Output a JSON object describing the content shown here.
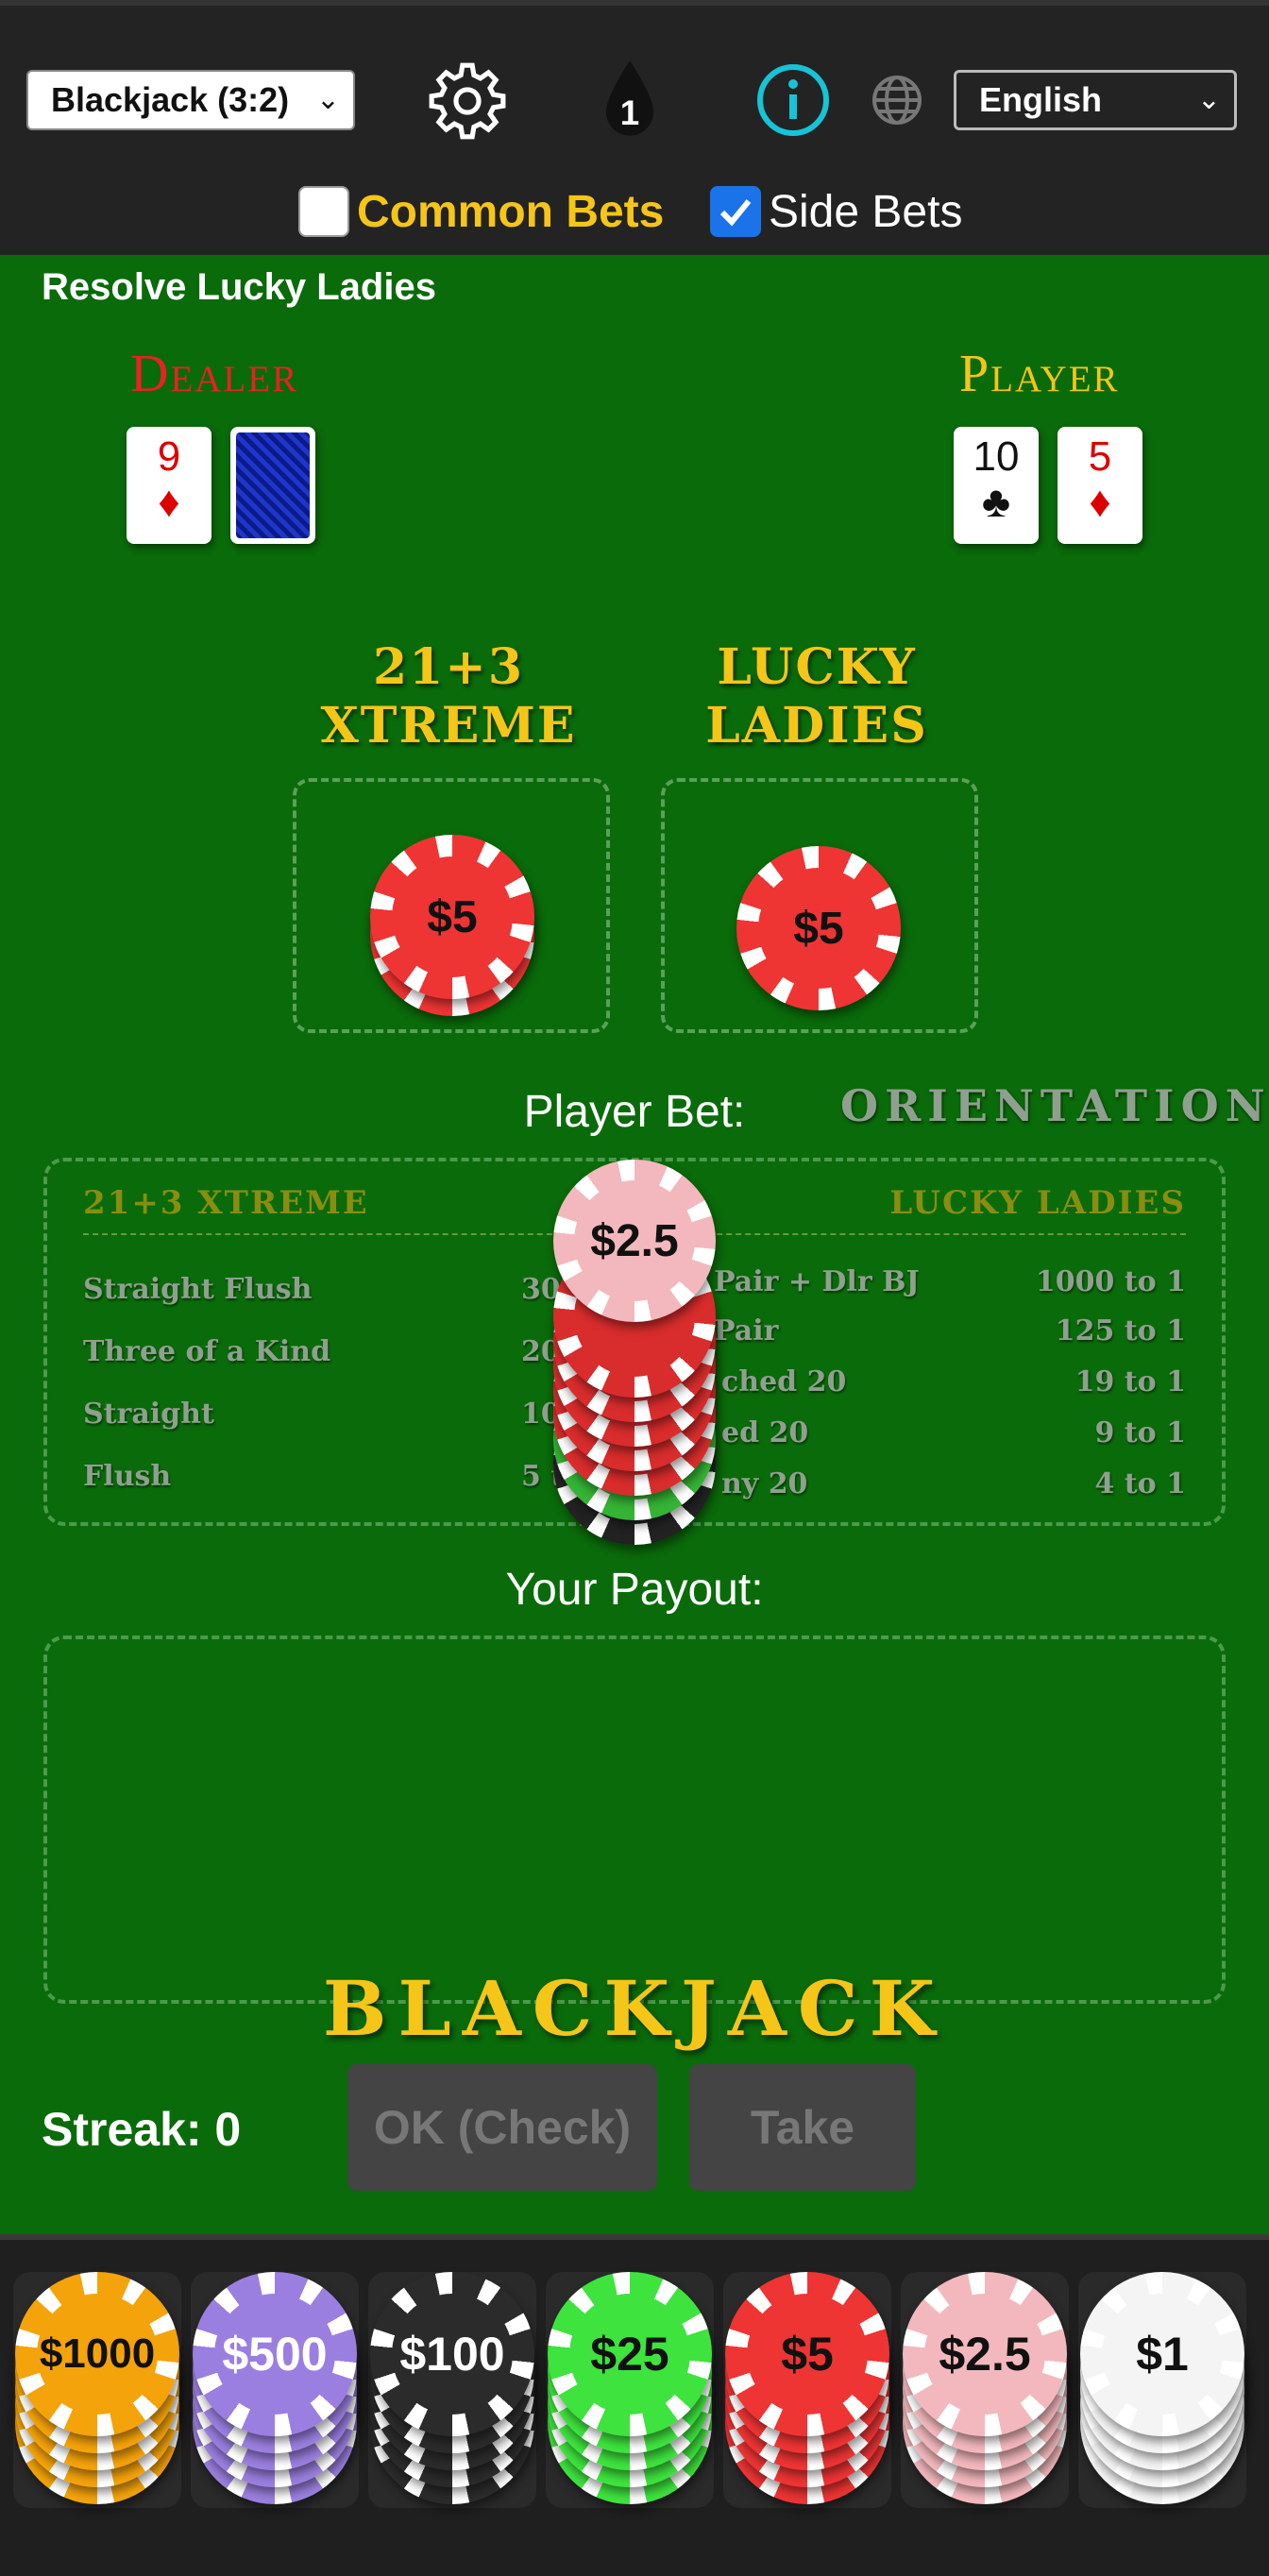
{
  "header": {
    "game_select": "Blackjack (3:2)",
    "count_badge": "1",
    "language_select": "English",
    "options": {
      "common_bets": "Common Bets",
      "side_bets": "Side Bets"
    },
    "common_bets_checked": false,
    "side_bets_checked": true
  },
  "status": "Resolve Lucky Ladies",
  "dealer": {
    "title": "Dealer",
    "cards": [
      {
        "rank": "9",
        "suit": "♦",
        "color": "red"
      }
    ],
    "hole_card": "face-down"
  },
  "player": {
    "title": "Player",
    "cards": [
      {
        "rank": "10",
        "suit": "♣",
        "color": "black"
      },
      {
        "rank": "5",
        "suit": "♦",
        "color": "red"
      }
    ]
  },
  "side_bets": [
    {
      "title_line1": "21+3",
      "title_line2": "XTREME",
      "chip": "$5"
    },
    {
      "title_line1": "LUCKY",
      "title_line2": "LADIES",
      "chip": "$5"
    }
  ],
  "player_bet": {
    "label": "Player Bet:",
    "top_chip": "$2.5"
  },
  "orientation": "ORIENTATION",
  "paytable": {
    "left_title": "21+3 XTREME",
    "right_title": "LUCKY LADIES",
    "left_rows": [
      {
        "name": "Straight Flush",
        "pay": "30"
      },
      {
        "name": "Three of a Kind",
        "pay": "20"
      },
      {
        "name": "Straight",
        "pay": "10"
      },
      {
        "name": "Flush",
        "pay": "5 to 1"
      }
    ],
    "right_rows": [
      {
        "name": "Pair + Dlr BJ",
        "pay": "1000 to 1"
      },
      {
        "name": "Pair",
        "pay": "125 to 1"
      },
      {
        "name": "ched 20",
        "pay": "19 to 1"
      },
      {
        "name": "ed 20",
        "pay": "9 to 1"
      },
      {
        "name": "ny 20",
        "pay": "4 to 1"
      }
    ]
  },
  "payout_label": "Your Payout:",
  "brand": "BLACKJACK",
  "streak": "Streak: 0",
  "buttons": {
    "ok": "OK (Check)",
    "take": "Take"
  },
  "chip_tray": [
    {
      "label": "$1000",
      "color": "#f5a30a",
      "text": "#111"
    },
    {
      "label": "$500",
      "color": "#9b7fe0",
      "text": "#fff"
    },
    {
      "label": "$100",
      "color": "#2b2b2b",
      "text": "#fff"
    },
    {
      "label": "$25",
      "color": "#3ee33e",
      "text": "#111"
    },
    {
      "label": "$5",
      "color": "#ef3434",
      "text": "#111"
    },
    {
      "label": "$2.5",
      "color": "#f3b8bd",
      "text": "#111"
    },
    {
      "label": "$1",
      "color": "#f4f4f4",
      "text": "#111"
    }
  ]
}
